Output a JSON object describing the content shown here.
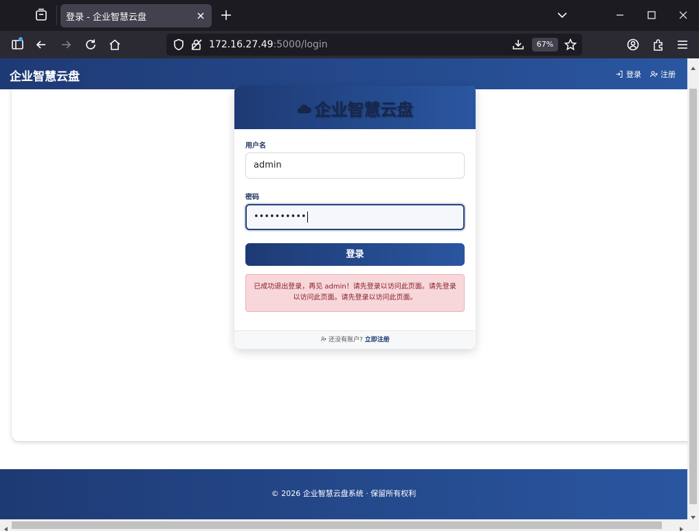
{
  "browser": {
    "tab_title": "登录 - 企业智慧云盘",
    "url_host": "172.16.27.49",
    "url_rest": ":5000/login",
    "zoom": "67%"
  },
  "site": {
    "brand": "企业智慧云盘",
    "nav_login": "登录",
    "nav_register": "注册"
  },
  "login": {
    "title": "企业智慧云盘",
    "username_label": "用户名",
    "username_value": "admin",
    "password_label": "密码",
    "password_value": "••••••••••",
    "submit_label": "登录",
    "alert_message": "已成功退出登录，再见 admin！请先登录以访问此页面。请先登录以访问此页面。请先登录以访问此页面。",
    "footer_prompt": "还没有账户?",
    "footer_link": "立即注册"
  },
  "footer": {
    "copyright": "© 2026 企业智慧云盘系统 · 保留所有权利"
  },
  "colors": {
    "brand_dark": "#1e3a74",
    "brand_light": "#2a56a0",
    "alert_bg": "#f8d7da",
    "alert_text": "#842029"
  }
}
